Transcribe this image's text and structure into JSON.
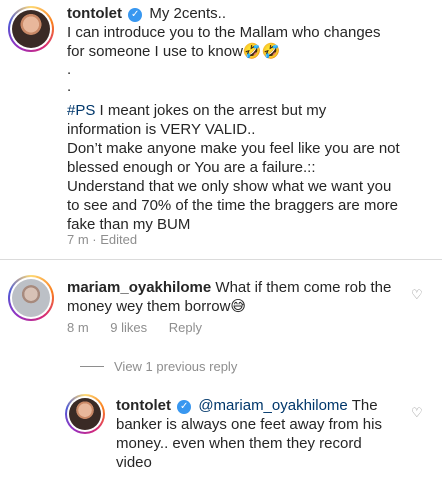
{
  "post": {
    "username": "tontolet",
    "lines": [
      "My 2cents..",
      "I can introduce you to the Mallam who changes",
      "for someone I use to know🤣🤣",
      ".",
      ".",
      "I meant jokes on the arrest but my",
      "information is VERY VALID..",
      "Don’t make anyone make you feel like you are not",
      "blessed enough or You are a failure.::",
      "Understand that we only show what we want you",
      "to see and 70% of the time the braggers are more",
      "fake than my BUM"
    ],
    "hashtag": "#PS",
    "time": "7 m",
    "edited": "Edited"
  },
  "comment": {
    "username": "mariam_oyakhilome",
    "text_line1": "What if them come rob the",
    "text_line2": "money wey them borrow😅",
    "time": "8 m",
    "likes": "9 likes",
    "reply_label": "Reply"
  },
  "view_replies": "View 1 previous reply",
  "reply": {
    "username": "tontolet",
    "mention": "@mariam_oyakhilome",
    "text_after_mention": "The",
    "line2": "banker is always one feet away from his",
    "line3": "money.. even when them they record",
    "line4": "video"
  },
  "icons": {
    "verified": "verified-badge-icon",
    "heart": "heart-outline-icon"
  },
  "colors": {
    "link": "#00376b",
    "secondary": "#8e8e8e",
    "verified": "#3897f0"
  }
}
